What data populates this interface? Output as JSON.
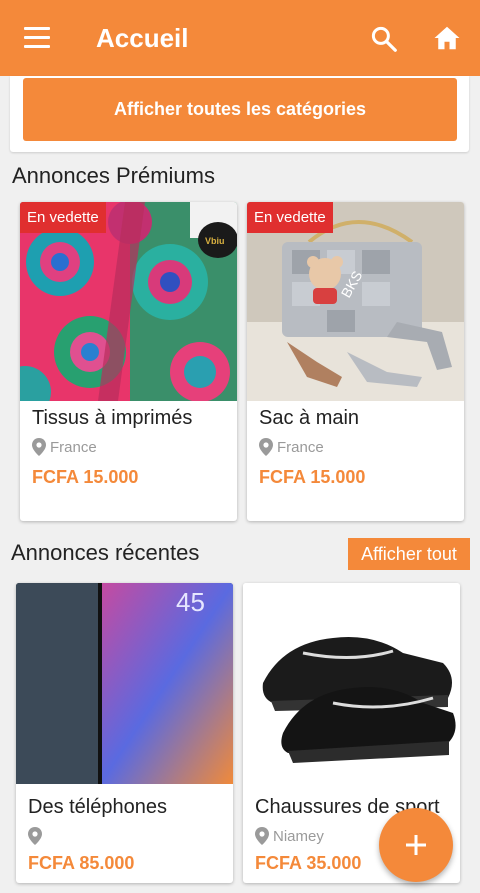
{
  "header": {
    "menu_icon": "hamburger-menu-icon",
    "title": "Accueil",
    "search_icon": "search-icon",
    "home_icon": "home-icon"
  },
  "categories_button": "Afficher toutes les catégories",
  "premium": {
    "title": "Annonces Prémiums",
    "items": [
      {
        "badge": "En vedette",
        "name": "Tissus à imprimés",
        "location": "France",
        "price": "FCFA 15.000"
      },
      {
        "badge": "En vedette",
        "name": "Sac à main",
        "location": "France",
        "price": "FCFA 15.000"
      }
    ]
  },
  "recent": {
    "title": "Annonces récentes",
    "see_all": "Afficher tout",
    "items": [
      {
        "name": "Des téléphones",
        "location": "",
        "price": "FCFA 85.000",
        "screen_time": "45"
      },
      {
        "name": "Chaussures de sport",
        "location": "Niamey",
        "price": "FCFA 35.000"
      }
    ]
  },
  "colors": {
    "accent": "#f4893a",
    "badge": "#e02f2f"
  },
  "fab_icon": "plus-icon"
}
